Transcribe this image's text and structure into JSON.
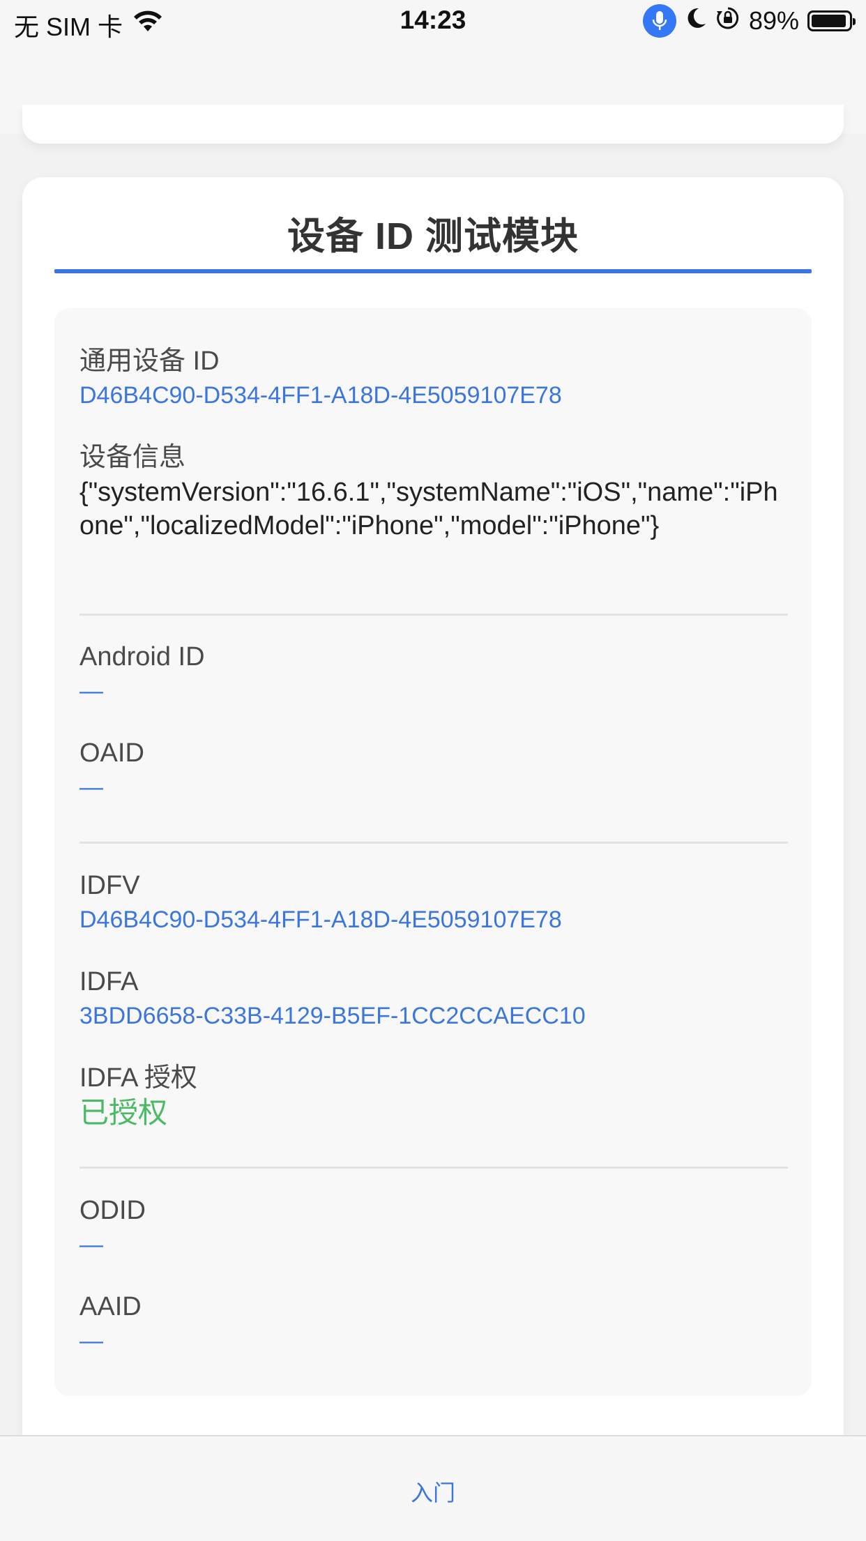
{
  "status_bar": {
    "carrier": "无 SIM 卡",
    "time": "14:23",
    "battery": "89%",
    "battery_level": 0.89,
    "icons": [
      "wifi-icon",
      "microphone-icon",
      "moon-icon",
      "orientation-lock-icon",
      "battery-icon"
    ]
  },
  "card": {
    "title": "设备 ID 测试模块"
  },
  "fields": {
    "universal_id": {
      "label": "通用设备 ID",
      "value": "D46B4C90-D534-4FF1-A18D-4E5059107E78"
    },
    "device_info": {
      "label": "设备信息",
      "value": "{\"systemVersion\":\"16.6.1\",\"systemName\":\"iOS\",\"name\":\"iPhone\",\"localizedModel\":\"iPhone\",\"model\":\"iPhone\"}"
    },
    "android_id": {
      "label": "Android ID",
      "value": "—"
    },
    "oaid": {
      "label": "OAID",
      "value": "—"
    },
    "idfv": {
      "label": "IDFV",
      "value": "D46B4C90-D534-4FF1-A18D-4E5059107E78"
    },
    "idfa": {
      "label": "IDFA",
      "value": "3BDD6658-C33B-4129-B5EF-1CC2CCAECC10"
    },
    "idfa_auth": {
      "label": "IDFA 授权",
      "value": "已授权"
    },
    "odid": {
      "label": "ODID",
      "value": "—"
    },
    "aaid": {
      "label": "AAID",
      "value": "—"
    }
  },
  "tab_bar": {
    "item": "入门"
  },
  "colors": {
    "accent": "#3b76de",
    "authorized": "#4cb964"
  }
}
